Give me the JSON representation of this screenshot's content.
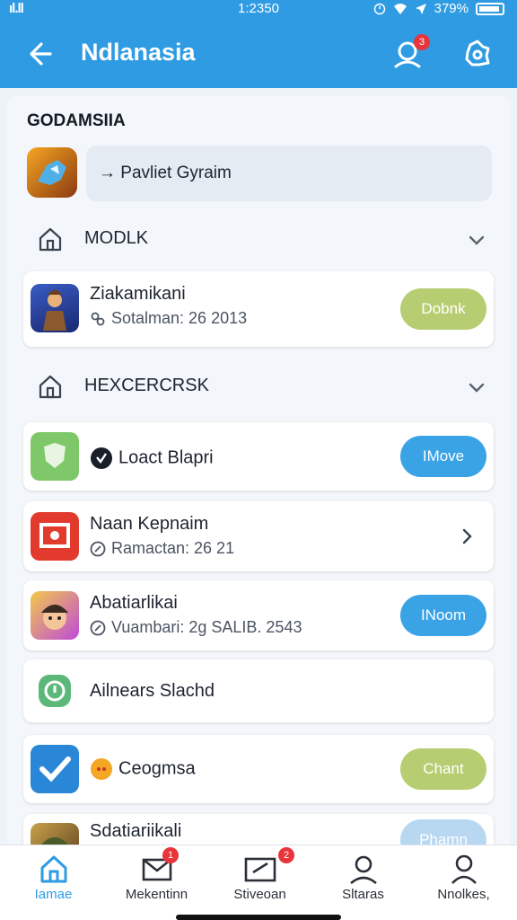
{
  "status_bar": {
    "signal": "ıl.ll",
    "time": "1:2350",
    "battery": "379%"
  },
  "header": {
    "title": "Ndlanasia",
    "notification_count": "3"
  },
  "section": {
    "title": "GODAMSIIA"
  },
  "search": {
    "text": "Pavliet Gyraim",
    "arrow": "→"
  },
  "group1": {
    "label": "MODLK"
  },
  "group2": {
    "label": "HEXCERCRSK"
  },
  "items": [
    {
      "title": "Ziakamikani",
      "subtitle": "Sotalman: 26 2013",
      "button": "Dobnk"
    },
    {
      "title": "Loact Blapri",
      "button": "IMove"
    },
    {
      "title": "Naan Kepnaim",
      "subtitle": "Ramactan: 26 21"
    },
    {
      "title": "Abatiarlikai",
      "subtitle": "Vuambari: 2g SALIB. 2543",
      "button": "INoom"
    },
    {
      "title": "Ailnears Slachd"
    },
    {
      "title": "Ceogmsa",
      "button": "Chant"
    },
    {
      "title": "Sdatiariikali",
      "button": "Phamn"
    }
  ],
  "tabs": [
    {
      "label": "Iamae",
      "badge": ""
    },
    {
      "label": "Mekentinn",
      "badge": "1"
    },
    {
      "label": "Stiveoan",
      "badge": "2"
    },
    {
      "label": "Sltaras",
      "badge": ""
    },
    {
      "label": "Nnolkes,",
      "badge": ""
    }
  ],
  "colors": {
    "header": "#2e9be3",
    "green_button": "#b7cd72",
    "blue_button": "#3aa3e6",
    "badge": "#e8343a"
  },
  "icons": {
    "back": "arrow-left-icon",
    "notifications": "person-search-icon",
    "settings": "settings-icon",
    "group": "home-icon",
    "expand": "chevron-down-icon",
    "row_arrow": "chevron-right-icon"
  }
}
